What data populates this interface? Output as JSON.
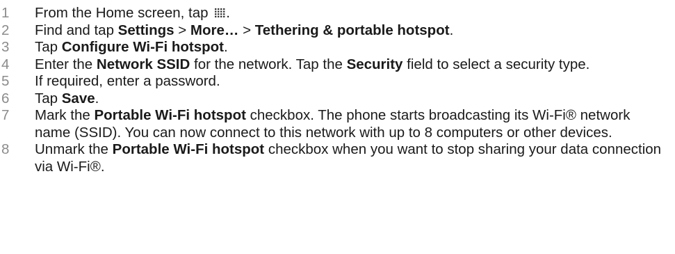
{
  "steps": [
    {
      "number": "1",
      "segments": [
        {
          "text": "From the Home screen, tap "
        },
        {
          "icon": "apps-grid-icon"
        },
        {
          "text": "."
        }
      ]
    },
    {
      "number": "2",
      "segments": [
        {
          "text": "Find and tap "
        },
        {
          "text": "Settings",
          "bold": true
        },
        {
          "text": " > "
        },
        {
          "text": "More…",
          "bold": true
        },
        {
          "text": " > "
        },
        {
          "text": "Tethering & portable hotspot",
          "bold": true
        },
        {
          "text": "."
        }
      ]
    },
    {
      "number": "3",
      "segments": [
        {
          "text": "Tap "
        },
        {
          "text": "Configure Wi-Fi hotspot",
          "bold": true
        },
        {
          "text": "."
        }
      ]
    },
    {
      "number": "4",
      "segments": [
        {
          "text": "Enter the "
        },
        {
          "text": "Network SSID",
          "bold": true
        },
        {
          "text": " for the network. Tap the "
        },
        {
          "text": "Security",
          "bold": true
        },
        {
          "text": " field to select a security type."
        }
      ]
    },
    {
      "number": "5",
      "segments": [
        {
          "text": "If required, enter a password."
        }
      ]
    },
    {
      "number": "6",
      "segments": [
        {
          "text": "Tap "
        },
        {
          "text": "Save",
          "bold": true
        },
        {
          "text": "."
        }
      ]
    },
    {
      "number": "7",
      "segments": [
        {
          "text": "Mark the "
        },
        {
          "text": "Portable Wi-Fi hotspot",
          "bold": true
        },
        {
          "text": " checkbox. The phone starts broadcasting its Wi-Fi® network name (SSID). You can now connect to this network with up to 8 computers or other devices."
        }
      ]
    },
    {
      "number": "8",
      "segments": [
        {
          "text": "Unmark the "
        },
        {
          "text": "Portable Wi-Fi hotspot",
          "bold": true
        },
        {
          "text": " checkbox when you want to stop sharing your data connection via Wi-Fi®."
        }
      ]
    }
  ]
}
